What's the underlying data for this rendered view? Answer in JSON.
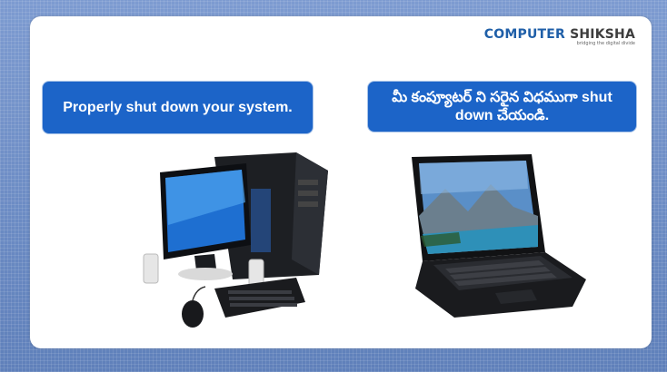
{
  "logo": {
    "word1": "COMPUTER",
    "word2": "SHIKSHA",
    "tagline": "bridging the digital divide"
  },
  "captions": {
    "english": "Properly shut down your system.",
    "telugu": "మీ కంప్యూటర్ ని సరైన విధముగా shut down చేయండి."
  },
  "images": {
    "desktop": "desktop-computer",
    "laptop": "laptop-computer"
  },
  "colors": {
    "background": "#6f8fc4",
    "pill": "#1c64c8",
    "logo_blue": "#1f5fa8"
  }
}
